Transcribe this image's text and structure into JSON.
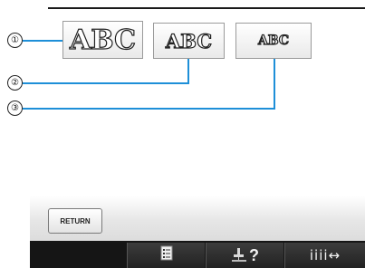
{
  "callouts": [
    "①",
    "②",
    "③"
  ],
  "size_buttons": [
    {
      "label": "ABC",
      "size": "large"
    },
    {
      "label": "ABC",
      "size": "medium"
    },
    {
      "label": "ABC",
      "size": "small"
    }
  ],
  "return_button": {
    "label": "RETURN"
  },
  "toolbar": {
    "help_label": "?",
    "spacing_label": "iiii↔"
  },
  "icons": [
    "memo-list-icon",
    "sewing-machine-help-icon",
    "character-spacing-icon"
  ],
  "colors": {
    "callout_line": "#1e8fd8",
    "toolbar_bg": "#151515"
  }
}
